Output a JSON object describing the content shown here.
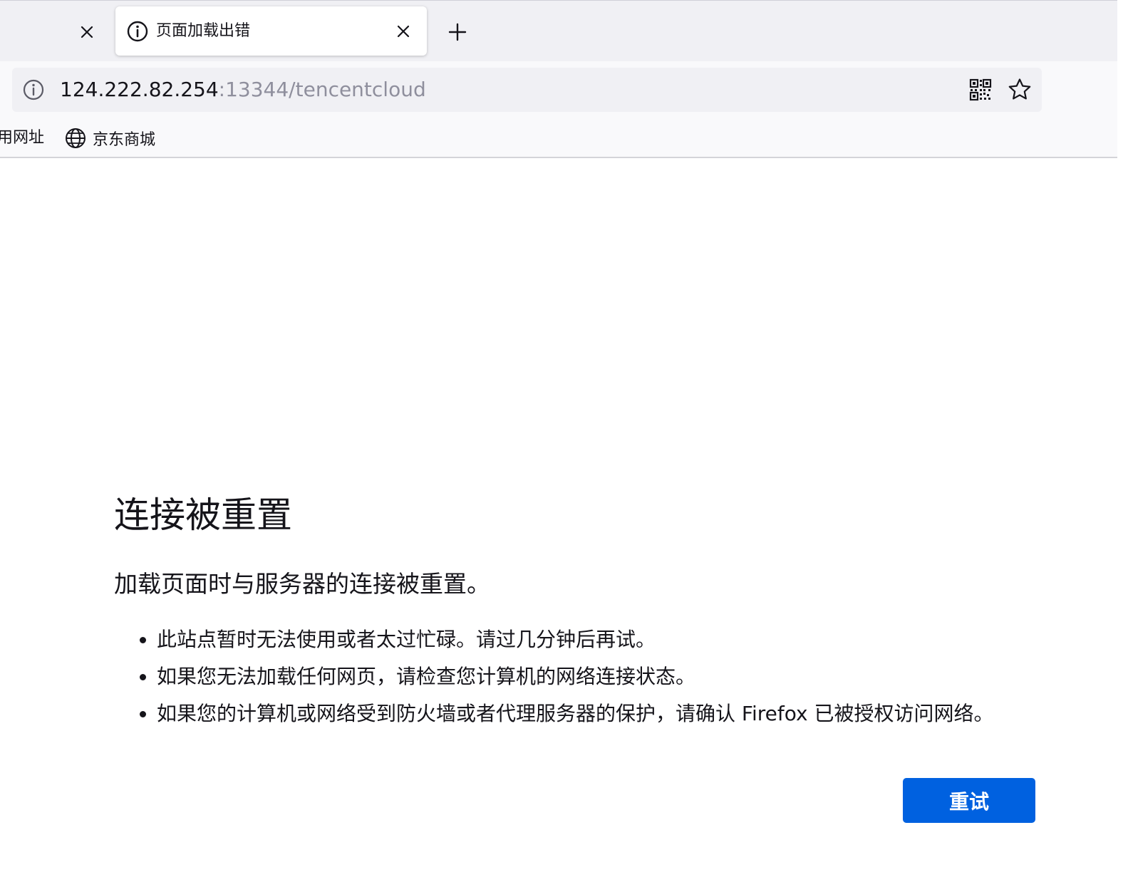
{
  "tabs": [
    {
      "title": ""
    },
    {
      "title": "页面加载出错",
      "active": true
    }
  ],
  "urlbar": {
    "host": "124.222.82.254",
    "rest": ":13344/tencentcloud"
  },
  "bookmarks": {
    "items": [
      {
        "label": "用网址"
      },
      {
        "label": "京东商城",
        "icon": "globe-icon"
      }
    ]
  },
  "error": {
    "title": "连接被重置",
    "description": "加载页面时与服务器的连接被重置。",
    "items": [
      "此站点暂时无法使用或者太过忙碌。请过几分钟后再试。",
      "如果您无法加载任何网页，请检查您计算机的网络连接状态。",
      "如果您的计算机或网络受到防火墙或者代理服务器的保护，请确认 Firefox 已被授权访问网络。"
    ],
    "retry_label": "重试"
  },
  "colors": {
    "accent": "#0061e0",
    "tabbar_bg": "#f0f0f4",
    "toolbar_bg": "#f9f9fb",
    "text": "#15141a",
    "muted_text": "#8f8f9d"
  }
}
